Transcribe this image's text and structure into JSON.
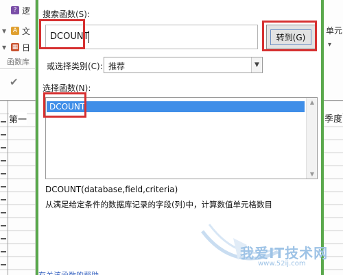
{
  "background": {
    "ribbon_items": [
      {
        "label": "逻",
        "icon": "help-book-icon",
        "color": "#7b4fa8"
      },
      {
        "label": "文",
        "icon": "text-icon",
        "color": "#e0a030"
      },
      {
        "label": "日",
        "icon": "calendar-icon",
        "color": "#c8502d"
      }
    ],
    "group_label": "函数库",
    "column_header_left": "第一",
    "right_ribbon_text": "单元",
    "column_header_right": "季度"
  },
  "dialog": {
    "search_label": "搜索函数(S):",
    "search_value": "DCOUNT",
    "go_button_label": "转到(G)",
    "category_label": "或选择类别(C):",
    "category_value": "推荐",
    "function_list_label": "选择函数(N):",
    "functions": [
      "DCOUNT"
    ],
    "syntax": "DCOUNT(database,field,criteria)",
    "description": "从满足给定条件的数据库记录的字段(列)中，计算数值单元格数目",
    "help_link": "有关该函数的帮助"
  },
  "watermark": {
    "text": "我爱IT技术网",
    "url": "www.52ij.com"
  },
  "colors": {
    "selection": "#3f8ee8",
    "annotation": "#d63030",
    "frame": "#5aa84c"
  }
}
